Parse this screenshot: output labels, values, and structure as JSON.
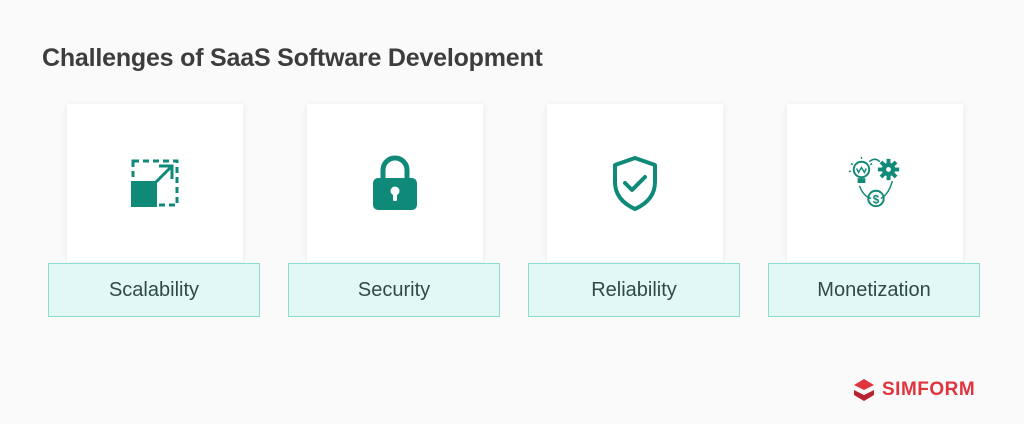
{
  "title": "Challenges of SaaS Software Development",
  "cards": [
    {
      "label": "Scalability",
      "icon": "scalability-icon"
    },
    {
      "label": "Security",
      "icon": "padlock-icon"
    },
    {
      "label": "Reliability",
      "icon": "shield-check-icon"
    },
    {
      "label": "Monetization",
      "icon": "monetization-icon"
    }
  ],
  "logo": {
    "text": "SIMFORM"
  },
  "colors": {
    "accent": "#0f8a78",
    "label_bg": "#e2f8f5",
    "label_border": "#8fdccd",
    "brand": "#e0343f"
  }
}
